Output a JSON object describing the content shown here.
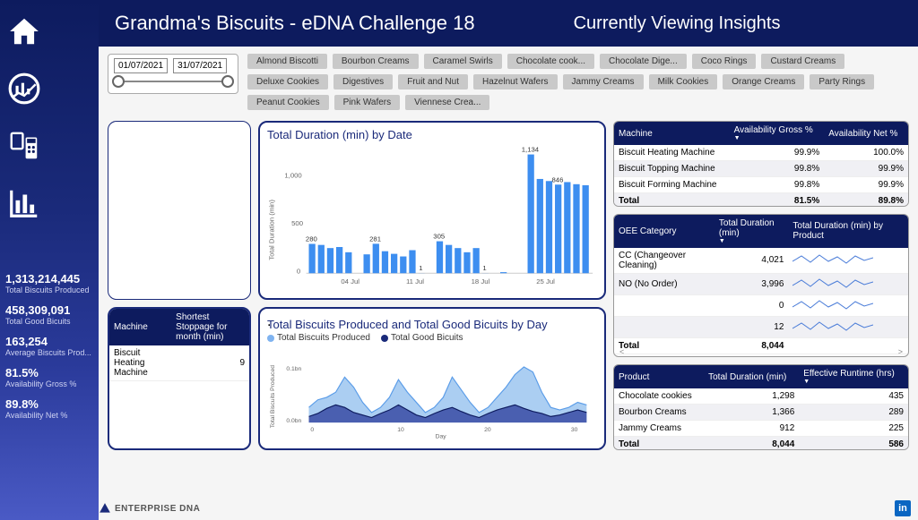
{
  "header": {
    "title": "Grandma's Biscuits - eDNA Challenge 18",
    "subtitle": "Currently Viewing Insights"
  },
  "date_range": {
    "from": "01/07/2021",
    "to": "31/07/2021"
  },
  "filter_chips": [
    "Almond Biscotti",
    "Bourbon Creams",
    "Caramel Swirls",
    "Chocolate cook...",
    "Chocolate Dige...",
    "Coco Rings",
    "Custard Creams",
    "Deluxe Cookies",
    "Digestives",
    "Fruit and Nut",
    "Hazelnut Wafers",
    "Jammy Creams",
    "Milk Cookies",
    "Orange Creams",
    "Party Rings",
    "Peanut Cookies",
    "Pink Wafers",
    "Viennese Crea..."
  ],
  "kpis": [
    {
      "value": "1,313,214,445",
      "label": "Total Biscuits Produced"
    },
    {
      "value": "458,309,091",
      "label": "Total Good Bicuits"
    },
    {
      "value": "163,254",
      "label": "Average Biscuits Prod..."
    },
    {
      "value": "81.5%",
      "label": "Availability Gross %"
    },
    {
      "value": "89.8%",
      "label": "Availability Net %"
    }
  ],
  "stoppage_table": {
    "headers": [
      "Machine",
      "Shortest Stoppage for month (min)"
    ],
    "rows": [
      {
        "machine": "Biscuit Heating Machine",
        "val": "9"
      }
    ]
  },
  "duration_chart": {
    "title": "Total Duration (min) by Date",
    "ylabel": "Total Duration (min)",
    "xticks": [
      "04 Jul",
      "11 Jul",
      "18 Jul",
      "25 Jul"
    ]
  },
  "produced_chart": {
    "title": "Total Biscuits Produced and Total Good Bicuits by Day",
    "legend": [
      "Total Biscuits Produced",
      "Total Good Bicuits"
    ],
    "ylabel": "Total Biscuits Produced",
    "xlab": "Day",
    "yticks": [
      "0.0bn",
      "0.1bn"
    ],
    "xticks": [
      "0",
      "10",
      "20",
      "30"
    ]
  },
  "machine_avail": {
    "headers": [
      "Machine",
      "Availability Gross %",
      "Availability Net %"
    ],
    "rows": [
      {
        "m": "Biscuit Heating Machine",
        "g": "99.9%",
        "n": "100.0%"
      },
      {
        "m": "Biscuit Topping Machine",
        "g": "99.8%",
        "n": "99.9%"
      },
      {
        "m": "Biscuit Forming Machine",
        "g": "99.8%",
        "n": "99.9%"
      }
    ],
    "total": {
      "m": "Total",
      "g": "81.5%",
      "n": "89.8%"
    }
  },
  "oee": {
    "headers": [
      "OEE Category",
      "Total Duration (min)",
      "Total Duration (min) by Product"
    ],
    "rows": [
      {
        "cat": "CC (Changeover Cleaning)",
        "dur": "4,021"
      },
      {
        "cat": "NO (No Order)",
        "dur": "3,996"
      },
      {
        "cat": "",
        "dur": "0"
      },
      {
        "cat": "",
        "dur": "12"
      }
    ],
    "total": {
      "cat": "Total",
      "dur": "8,044"
    }
  },
  "product_runtime": {
    "headers": [
      "Product",
      "Total Duration (min)",
      "Effective Runtime (hrs)"
    ],
    "rows": [
      {
        "p": "Chocolate cookies",
        "d": "1,298",
        "r": "435"
      },
      {
        "p": "Bourbon Creams",
        "d": "1,366",
        "r": "289"
      },
      {
        "p": "Jammy Creams",
        "d": "912",
        "r": "225"
      }
    ],
    "total": {
      "p": "Total",
      "d": "8,044",
      "r": "586"
    }
  },
  "footer_brand": "ENTERPRISE DNA",
  "chart_data": [
    {
      "type": "bar",
      "title": "Total Duration (min) by Date",
      "ylabel": "Total Duration (min)",
      "xlabel": "",
      "ylim": [
        0,
        1200
      ],
      "categories": [
        "01",
        "02",
        "03",
        "04",
        "05",
        "06",
        "07",
        "08",
        "09",
        "10",
        "11",
        "12",
        "13",
        "14",
        "15",
        "16",
        "17",
        "18",
        "19",
        "20",
        "21",
        "22",
        "23",
        "24",
        "25",
        "26",
        "27",
        "28",
        "29",
        "30",
        "31"
      ],
      "values": [
        280,
        270,
        240,
        250,
        200,
        0,
        180,
        281,
        210,
        185,
        160,
        220,
        1,
        0,
        305,
        270,
        240,
        200,
        240,
        1,
        0,
        10,
        0,
        0,
        1134,
        900,
        880,
        846,
        870,
        850,
        840
      ],
      "annotations": [
        {
          "x": "01",
          "y": 280,
          "label": "280"
        },
        {
          "x": "08",
          "y": 281,
          "label": "281"
        },
        {
          "x": "15",
          "y": 305,
          "label": "305"
        },
        {
          "x": "25",
          "y": 1134,
          "label": "1,134"
        },
        {
          "x": "28",
          "y": 846,
          "label": "846"
        },
        {
          "x": "13",
          "y": 1,
          "label": "1"
        },
        {
          "x": "20",
          "y": 1,
          "label": "1"
        }
      ]
    },
    {
      "type": "area",
      "title": "Total Biscuits Produced and Total Good Bicuits by Day",
      "xlabel": "Day",
      "ylabel": "Total Biscuits Produced",
      "ylim": [
        0,
        0.12
      ],
      "y_unit": "bn",
      "x": [
        0,
        1,
        2,
        3,
        4,
        5,
        6,
        7,
        8,
        9,
        10,
        11,
        12,
        13,
        14,
        15,
        16,
        17,
        18,
        19,
        20,
        21,
        22,
        23,
        24,
        25,
        26,
        27,
        28,
        29,
        30,
        31
      ],
      "series": [
        {
          "name": "Total Biscuits Produced",
          "values": [
            0.03,
            0.045,
            0.05,
            0.06,
            0.09,
            0.07,
            0.04,
            0.02,
            0.03,
            0.05,
            0.085,
            0.06,
            0.04,
            0.02,
            0.03,
            0.05,
            0.09,
            0.065,
            0.04,
            0.02,
            0.03,
            0.05,
            0.07,
            0.095,
            0.11,
            0.1,
            0.06,
            0.03,
            0.025,
            0.03,
            0.04,
            0.035
          ]
        },
        {
          "name": "Total Good Bicuits",
          "values": [
            0.012,
            0.018,
            0.028,
            0.035,
            0.03,
            0.02,
            0.015,
            0.01,
            0.018,
            0.025,
            0.035,
            0.025,
            0.015,
            0.01,
            0.018,
            0.025,
            0.03,
            0.022,
            0.015,
            0.01,
            0.018,
            0.025,
            0.03,
            0.035,
            0.028,
            0.022,
            0.018,
            0.012,
            0.015,
            0.02,
            0.025,
            0.02
          ]
        }
      ]
    }
  ]
}
